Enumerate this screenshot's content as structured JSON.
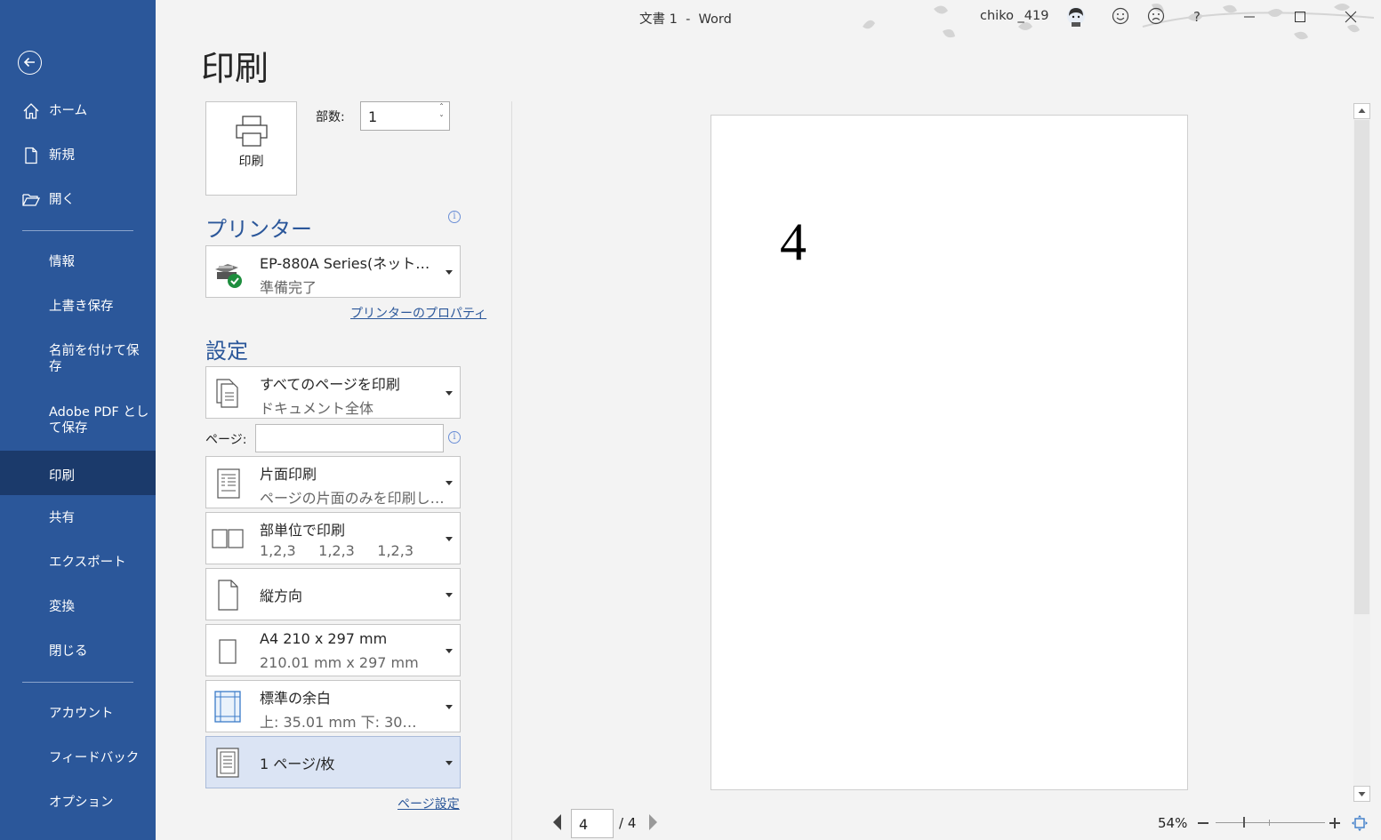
{
  "window": {
    "doc_title": "文書 1",
    "sep": "-",
    "app_name": "Word",
    "user": "chiko _419",
    "help": "?"
  },
  "sidebar": {
    "items": [
      {
        "label": "ホーム"
      },
      {
        "label": "新規"
      },
      {
        "label": "開く"
      },
      {
        "label": "情報"
      },
      {
        "label": "上書き保存"
      },
      {
        "label": "名前を付けて保\n存"
      },
      {
        "label": "Adobe PDF とし\nて保存"
      },
      {
        "label": "印刷"
      },
      {
        "label": "共有"
      },
      {
        "label": "エクスポート"
      },
      {
        "label": "変換"
      },
      {
        "label": "閉じる"
      },
      {
        "label": "アカウント"
      },
      {
        "label": "フィードバック"
      },
      {
        "label": "オプション"
      }
    ]
  },
  "print": {
    "title": "印刷",
    "button_label": "印刷",
    "copies_label": "部数:",
    "copies_value": "1",
    "printer_heading": "プリンター",
    "printer_name": "EP-880A Series(ネット…",
    "printer_status": "準備完了",
    "printer_props_link": "プリンターのプロパティ",
    "settings_heading": "設定",
    "pages_label": "ページ:",
    "pages_value": "",
    "page_setup_link": "ページ設定",
    "settings": [
      {
        "main": "すべてのページを印刷",
        "sub": "ドキュメント全体"
      },
      {
        "main": "片面印刷",
        "sub": "ページの片面のみを印刷し…"
      },
      {
        "main": "部単位で印刷",
        "sub": "1,2,3     1,2,3     1,2,3"
      },
      {
        "main": "縦方向",
        "sub": ""
      },
      {
        "main": "A4 210 x 297 mm",
        "sub": "210.01 mm x 297 mm"
      },
      {
        "main": "標準の余白",
        "sub": "上: 35.01 mm 下: 30…"
      },
      {
        "main": "1 ページ/枚",
        "sub": ""
      }
    ]
  },
  "preview": {
    "page_content": "4",
    "current_page": "4",
    "total_pages": "/ 4",
    "zoom": "54%",
    "zoom_level": 0.54
  },
  "colors": {
    "sidebar": "#2b579a",
    "sidebar_selected": "#1b3a6b",
    "accent": "#2b579a"
  }
}
